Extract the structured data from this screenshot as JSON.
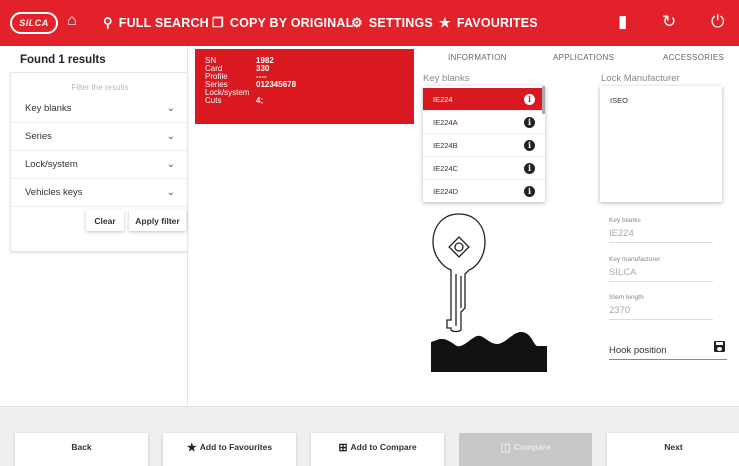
{
  "header": {
    "logo_text": "SILCA",
    "nav": {
      "full_search": "FULL SEARCH",
      "copy_by_original": "COPY BY ORIGINAL",
      "settings": "SETTINGS",
      "favourites": "FAVOURITES"
    }
  },
  "left": {
    "found": "Found 1 results",
    "filter_hint": "Filter the results",
    "filters": [
      "Key blanks",
      "Series",
      "Lock/system",
      "Vehicles keys"
    ],
    "clear_label": "Clear",
    "apply_label": "Apply filter"
  },
  "result": {
    "rows": [
      {
        "key": "SN",
        "value": "1982"
      },
      {
        "key": "Card",
        "value": "330"
      },
      {
        "key": "Profile",
        "value": "----"
      },
      {
        "key": "Series",
        "value": "012345678"
      },
      {
        "key": "Lock/system",
        "value": ""
      },
      {
        "key": "Cuts",
        "value": "4;"
      }
    ]
  },
  "tabs": [
    "INFORMATION",
    "APPLICATIONS",
    "ACCESSORIES"
  ],
  "key_blanks": {
    "label": "Key blanks",
    "items": [
      "IE224",
      "IE224A",
      "IE224B",
      "IE224C",
      "IE224D"
    ],
    "selected": "IE224"
  },
  "lock_manufacturer": {
    "label": "Lock Manufacturer",
    "items": [
      "ISEO"
    ]
  },
  "details": {
    "key_blanks_label": "Key blanks",
    "key_blanks_value": "IE224",
    "key_manufacturer_label": "Key manufacturer",
    "key_manufacturer_value": "SILCA",
    "stem_length_label": "Stem length",
    "stem_length_value": "2370",
    "hook_position_label": "Hook position"
  },
  "bottom": {
    "back": "Back",
    "add_favourites": "Add to Favourites",
    "add_compare": "Add to Compare",
    "compare": "Compare",
    "next": "Next"
  },
  "colors": {
    "brand_red": "#e3212a",
    "card_red": "#d9191f"
  }
}
